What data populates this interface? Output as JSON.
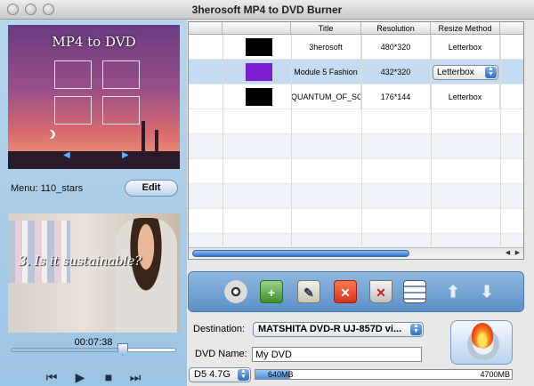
{
  "window": {
    "title": "3herosoft MP4 to DVD Burner"
  },
  "menu_preview": {
    "title": "MP4 to DVD"
  },
  "menu": {
    "label": "Menu: 110_stars",
    "edit_label": "Edit"
  },
  "video": {
    "caption": "3. Is it sustainable?",
    "timecode": "00:07:38",
    "position_fraction": 0.68
  },
  "table": {
    "columns": [
      "",
      "",
      "Title",
      "Resolution",
      "Resize Method"
    ],
    "rows": [
      {
        "swatch": "#000000",
        "title": "3herosoft",
        "resolution": "480*320",
        "resize": "Letterbox",
        "selected": false
      },
      {
        "swatch": "#7b1fd1",
        "title": "Module 5  Fashion",
        "resolution": "432*320",
        "resize": "Letterbox",
        "selected": true
      },
      {
        "swatch": "#000000",
        "title": "QUANTUM_OF_SO",
        "resolution": "176*144",
        "resize": "Letterbox",
        "selected": false
      }
    ]
  },
  "output": {
    "destination_label": "Destination:",
    "destination_value": "MATSHITA DVD-R   UJ-857D vi...",
    "dvd_name_label": "DVD Name:",
    "dvd_name_value": "My DVD",
    "disc_type": "D5 4.7G",
    "used": "640MB",
    "used_fraction": 0.136,
    "capacity": "4700MB"
  },
  "colors": {
    "accent": "#2f6fc9",
    "panel": "#a8cbe8",
    "selected_row": "#c5dbf2"
  }
}
